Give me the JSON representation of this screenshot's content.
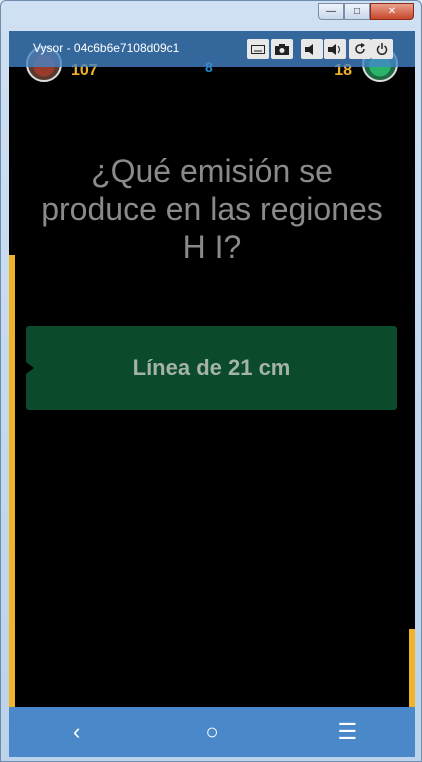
{
  "window": {
    "title": "Vysor - 04c6b6e7108d09c1",
    "controls": {
      "minimize": "—",
      "maximize": "□",
      "close": "✕"
    }
  },
  "vysor_toolbar": {
    "icons": [
      "keyboard-icon",
      "camera-icon",
      "volume-down-icon",
      "volume-up-icon",
      "rotate-icon",
      "power-icon"
    ]
  },
  "game": {
    "player_left": {
      "score": "107"
    },
    "player_right": {
      "score": "18"
    },
    "timer": "8",
    "question": "¿Qué emisión se produce en las regiones H I?",
    "answer": "Línea de 21 cm"
  },
  "navbar": {
    "back": "‹",
    "home": "○",
    "menu": "☰"
  },
  "colors": {
    "accent_yellow": "#f0b328",
    "answer_green": "#0b4a2a",
    "nav_blue": "#4a88c9",
    "timer_blue": "#1e8fd6"
  }
}
